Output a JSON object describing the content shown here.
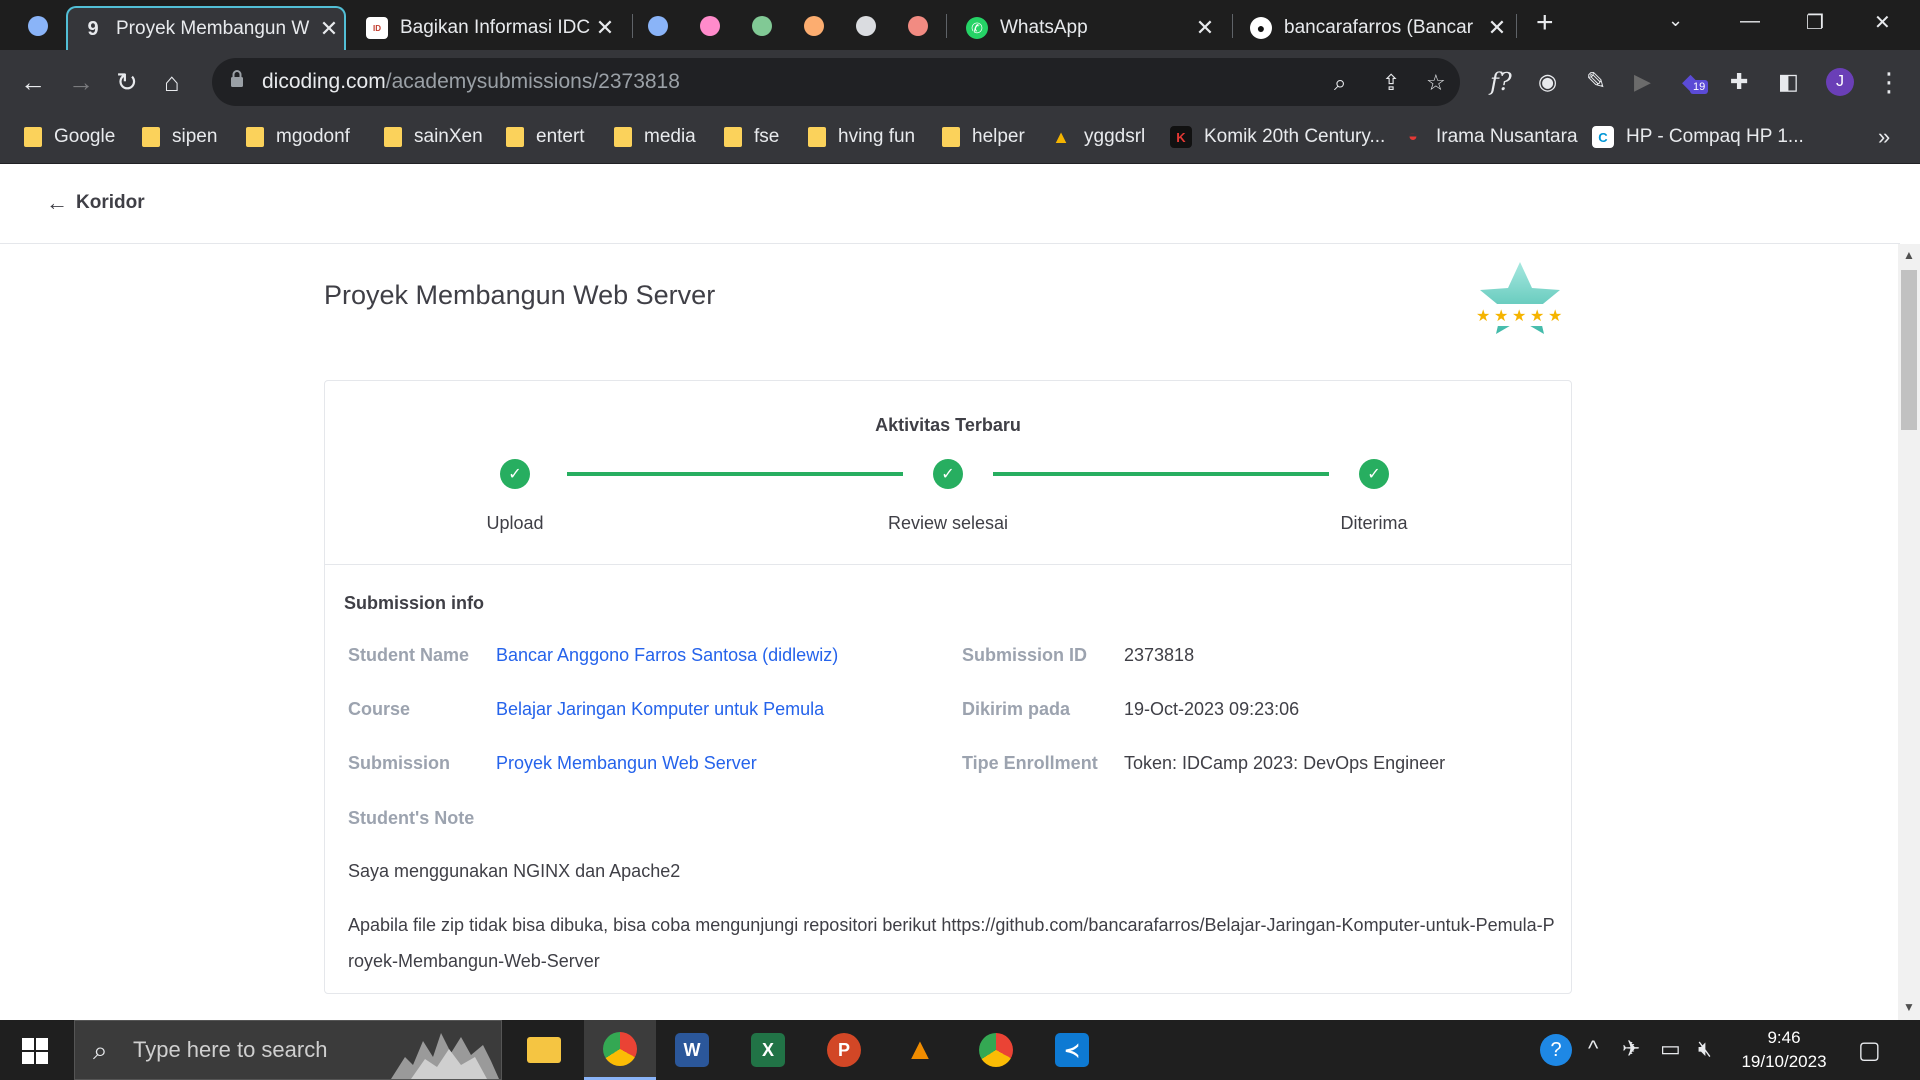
{
  "browser": {
    "tabs": [
      {
        "title": "Proyek Membangun W",
        "active": true,
        "favicon": "dicoding-icon"
      },
      {
        "title": "Bagikan Informasi IDCa",
        "active": false,
        "favicon": "idcamp-icon"
      },
      {
        "title": "WhatsApp",
        "active": false,
        "favicon": "whatsapp-icon"
      },
      {
        "title": "bancarafarros (Bancar",
        "active": false,
        "favicon": "github-icon"
      }
    ],
    "group_dot_colors": [
      "#8ab4f8",
      "#ff8bcb",
      "#81c995",
      "#fcad70",
      "#dadce0",
      "#f28b82"
    ],
    "url_host": "dicoding.com",
    "url_path": "/academysubmissions/2373818",
    "extension_badge": "19",
    "profile_initial": "J",
    "bookmarks": [
      "Google",
      "sipen",
      "mgodonf",
      "sainXen",
      "entert",
      "media",
      "fse",
      "hving fun",
      "helper",
      "yggdsrl",
      "Komik 20th Century...",
      "Irama Nusantara",
      "HP - Compaq HP 1..."
    ]
  },
  "page": {
    "back_label": "Koridor",
    "title": "Proyek Membangun Web Server",
    "rating_stars": 5,
    "activity": {
      "title": "Aktivitas Terbaru",
      "steps": [
        "Upload",
        "Review selesai",
        "Diterima"
      ]
    },
    "submission_info": {
      "title": "Submission info",
      "student_name_label": "Student Name",
      "student_name": "Bancar Anggono Farros Santosa (didlewiz)",
      "course_label": "Course",
      "course": "Belajar Jaringan Komputer untuk Pemula",
      "submission_label": "Submission",
      "submission": "Proyek Membangun Web Server",
      "submission_id_label": "Submission ID",
      "submission_id": "2373818",
      "sent_label": "Dikirim pada",
      "sent": "19-Oct-2023 09:23:06",
      "enrollment_label": "Tipe Enrollment",
      "enrollment": "Token: IDCamp 2023: DevOps Engineer",
      "note_label": "Student's Note",
      "note_line1": "Saya menggunakan NGINX dan Apache2",
      "note_line2": "Apabila file zip tidak bisa dibuka, bisa coba mengunjungi repositori berikut https://github.com/bancarafarros/Belajar-Jaringan-Komputer-untuk-Pemula-Proyek-Membangun-Web-Server"
    }
  },
  "taskbar": {
    "search_placeholder": "Type here to search",
    "time": "9:46",
    "date": "19/10/2023"
  },
  "colors": {
    "accent_green": "#27ae60",
    "link_blue": "#2563eb",
    "label_gray": "#9ca3af"
  }
}
